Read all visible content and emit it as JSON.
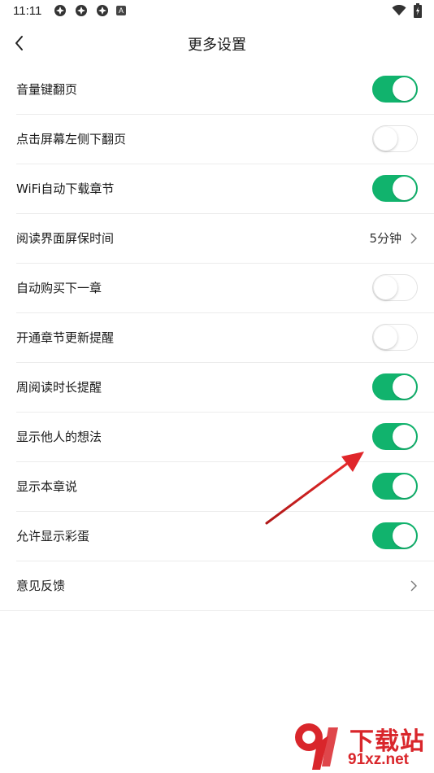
{
  "status_bar": {
    "time": "11:11",
    "notif_letter": "A"
  },
  "header": {
    "title": "更多设置",
    "back_icon": "chevron-left-icon"
  },
  "colors": {
    "accent": "#11b36d",
    "arrow": "#d9262b",
    "watermark": "#d9262b"
  },
  "settings": [
    {
      "label": "音量键翻页",
      "type": "toggle",
      "on": true
    },
    {
      "label": "点击屏幕左侧下翻页",
      "type": "toggle",
      "on": false
    },
    {
      "label": "WiFi自动下载章节",
      "type": "toggle",
      "on": true
    },
    {
      "label": "阅读界面屏保时间",
      "type": "value",
      "value": "5分钟"
    },
    {
      "label": "自动购买下一章",
      "type": "toggle",
      "on": false
    },
    {
      "label": "开通章节更新提醒",
      "type": "toggle",
      "on": false
    },
    {
      "label": "周阅读时长提醒",
      "type": "toggle",
      "on": true
    },
    {
      "label": "显示他人的想法",
      "type": "toggle",
      "on": true
    },
    {
      "label": "显示本章说",
      "type": "toggle",
      "on": true
    },
    {
      "label": "允许显示彩蛋",
      "type": "toggle",
      "on": true
    },
    {
      "label": "意见反馈",
      "type": "link"
    }
  ],
  "watermark": {
    "cn": "下载站",
    "url": "91xz.net"
  }
}
